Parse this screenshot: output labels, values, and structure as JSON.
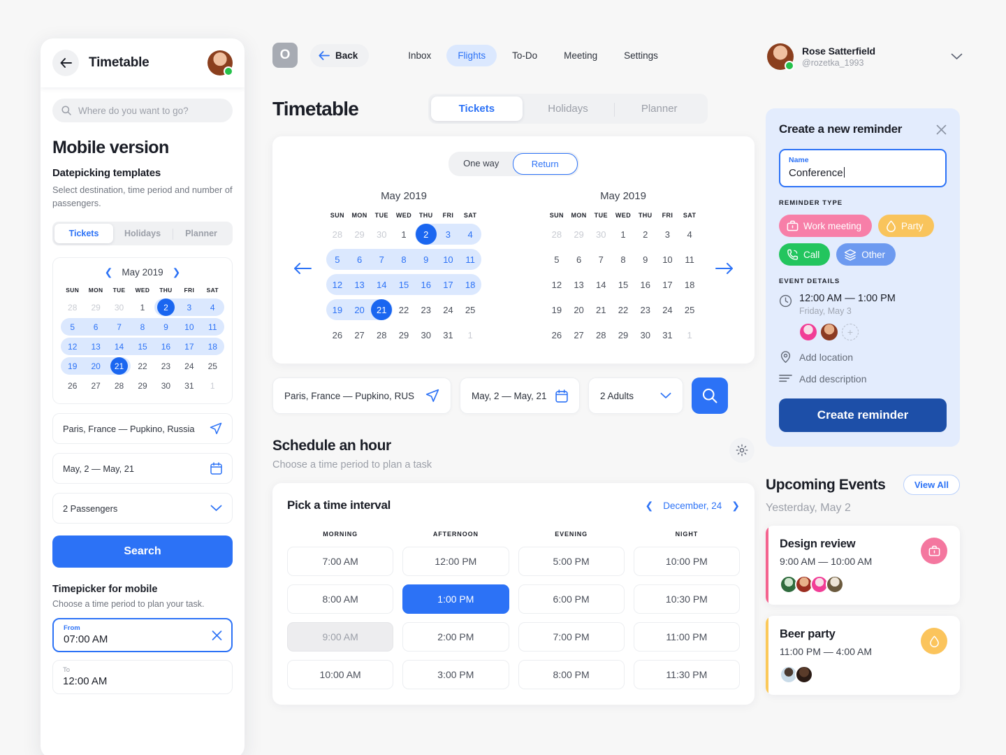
{
  "mobile": {
    "header_title": "Timetable",
    "back_icon": "arrow-left-icon",
    "search_placeholder": "Where do you want to go?",
    "h1": "Mobile version",
    "h2": "Datepicking templates",
    "paragraph": "Select destination, time period and number of passengers.",
    "tabs": [
      {
        "label": "Tickets",
        "active": true
      },
      {
        "label": "Holidays",
        "active": false
      },
      {
        "label": "Planner",
        "active": false
      }
    ],
    "calendar": {
      "month": "May 2019",
      "dow": [
        "SUN",
        "MON",
        "TUE",
        "WED",
        "THU",
        "FRI",
        "SAT"
      ],
      "weeks": [
        [
          {
            "d": "28",
            "s": "mut"
          },
          {
            "d": "29",
            "s": "mut"
          },
          {
            "d": "30",
            "s": "mut"
          },
          {
            "d": "1",
            "s": ""
          },
          {
            "d": "2",
            "s": "sel"
          },
          {
            "d": "3",
            "s": "inr"
          },
          {
            "d": "4",
            "s": "inr"
          }
        ],
        [
          {
            "d": "5",
            "s": "inr"
          },
          {
            "d": "6",
            "s": "inr"
          },
          {
            "d": "7",
            "s": "inr"
          },
          {
            "d": "8",
            "s": "inr"
          },
          {
            "d": "9",
            "s": "inr"
          },
          {
            "d": "10",
            "s": "inr"
          },
          {
            "d": "11",
            "s": "inr"
          }
        ],
        [
          {
            "d": "12",
            "s": "inr"
          },
          {
            "d": "13",
            "s": "inr"
          },
          {
            "d": "14",
            "s": "inr"
          },
          {
            "d": "15",
            "s": "inr"
          },
          {
            "d": "16",
            "s": "inr"
          },
          {
            "d": "17",
            "s": "inr"
          },
          {
            "d": "18",
            "s": "inr"
          }
        ],
        [
          {
            "d": "19",
            "s": "inr"
          },
          {
            "d": "20",
            "s": "inr"
          },
          {
            "d": "21",
            "s": "sel"
          },
          {
            "d": "22",
            "s": ""
          },
          {
            "d": "23",
            "s": ""
          },
          {
            "d": "24",
            "s": ""
          },
          {
            "d": "25",
            "s": ""
          }
        ],
        [
          {
            "d": "26",
            "s": ""
          },
          {
            "d": "27",
            "s": ""
          },
          {
            "d": "28",
            "s": ""
          },
          {
            "d": "29",
            "s": ""
          },
          {
            "d": "30",
            "s": ""
          },
          {
            "d": "31",
            "s": ""
          },
          {
            "d": "1",
            "s": "mut"
          }
        ]
      ]
    },
    "route_field": "Paris, France — Pupkino, Russia",
    "dates_field": "May, 2 — May, 21",
    "passengers_field": "2 Passengers",
    "search_button": "Search",
    "timepicker_title": "Timepicker for mobile",
    "timepicker_sub": "Choose a time period to plan your task.",
    "from_label": "From",
    "from_value": "07:00 AM",
    "to_label": "To",
    "to_value": "12:00 AM"
  },
  "topbar": {
    "logo_letter": "O",
    "back_label": "Back",
    "nav": [
      {
        "label": "Inbox",
        "active": false
      },
      {
        "label": "Flights",
        "active": true
      },
      {
        "label": "To-Do",
        "active": false
      },
      {
        "label": "Meeting",
        "active": false
      },
      {
        "label": "Settings",
        "active": false
      }
    ]
  },
  "profile": {
    "name": "Rose Satterfield",
    "handle": "@rozetka_1993"
  },
  "timetable": {
    "title": "Timetable",
    "tabs": [
      {
        "label": "Tickets",
        "active": true
      },
      {
        "label": "Holidays",
        "active": false
      },
      {
        "label": "Planner",
        "active": false
      }
    ],
    "trip_type": [
      {
        "label": "One way",
        "active": false
      },
      {
        "label": "Return",
        "active": true
      }
    ],
    "calendar_left": {
      "month": "May 2019",
      "dow": [
        "SUN",
        "MON",
        "TUE",
        "WED",
        "THU",
        "FRI",
        "SAT"
      ],
      "weeks": [
        [
          {
            "d": "28",
            "s": "mut"
          },
          {
            "d": "29",
            "s": "mut"
          },
          {
            "d": "30",
            "s": "mut"
          },
          {
            "d": "1",
            "s": ""
          },
          {
            "d": "2",
            "s": "sel"
          },
          {
            "d": "3",
            "s": "inr"
          },
          {
            "d": "4",
            "s": "inr"
          }
        ],
        [
          {
            "d": "5",
            "s": "inr"
          },
          {
            "d": "6",
            "s": "inr"
          },
          {
            "d": "7",
            "s": "inr"
          },
          {
            "d": "8",
            "s": "inr"
          },
          {
            "d": "9",
            "s": "inr"
          },
          {
            "d": "10",
            "s": "inr"
          },
          {
            "d": "11",
            "s": "inr"
          }
        ],
        [
          {
            "d": "12",
            "s": "inr"
          },
          {
            "d": "13",
            "s": "inr"
          },
          {
            "d": "14",
            "s": "inr"
          },
          {
            "d": "15",
            "s": "inr"
          },
          {
            "d": "16",
            "s": "inr"
          },
          {
            "d": "17",
            "s": "inr"
          },
          {
            "d": "18",
            "s": "inr"
          }
        ],
        [
          {
            "d": "19",
            "s": "inr"
          },
          {
            "d": "20",
            "s": "inr"
          },
          {
            "d": "21",
            "s": "sel"
          },
          {
            "d": "22",
            "s": ""
          },
          {
            "d": "23",
            "s": ""
          },
          {
            "d": "24",
            "s": ""
          },
          {
            "d": "25",
            "s": ""
          }
        ],
        [
          {
            "d": "26",
            "s": ""
          },
          {
            "d": "27",
            "s": ""
          },
          {
            "d": "28",
            "s": ""
          },
          {
            "d": "29",
            "s": ""
          },
          {
            "d": "30",
            "s": ""
          },
          {
            "d": "31",
            "s": ""
          },
          {
            "d": "1",
            "s": "mut"
          }
        ]
      ]
    },
    "calendar_right": {
      "month": "May 2019",
      "dow": [
        "SUN",
        "MON",
        "TUE",
        "WED",
        "THU",
        "FRI",
        "SAT"
      ],
      "weeks": [
        [
          {
            "d": "28",
            "s": "mut"
          },
          {
            "d": "29",
            "s": "mut"
          },
          {
            "d": "30",
            "s": "mut"
          },
          {
            "d": "1",
            "s": ""
          },
          {
            "d": "2",
            "s": ""
          },
          {
            "d": "3",
            "s": ""
          },
          {
            "d": "4",
            "s": ""
          }
        ],
        [
          {
            "d": "5",
            "s": ""
          },
          {
            "d": "6",
            "s": ""
          },
          {
            "d": "7",
            "s": ""
          },
          {
            "d": "8",
            "s": ""
          },
          {
            "d": "9",
            "s": ""
          },
          {
            "d": "10",
            "s": ""
          },
          {
            "d": "11",
            "s": ""
          }
        ],
        [
          {
            "d": "12",
            "s": ""
          },
          {
            "d": "13",
            "s": ""
          },
          {
            "d": "14",
            "s": ""
          },
          {
            "d": "15",
            "s": ""
          },
          {
            "d": "16",
            "s": ""
          },
          {
            "d": "17",
            "s": ""
          },
          {
            "d": "18",
            "s": ""
          }
        ],
        [
          {
            "d": "19",
            "s": ""
          },
          {
            "d": "20",
            "s": ""
          },
          {
            "d": "21",
            "s": ""
          },
          {
            "d": "22",
            "s": ""
          },
          {
            "d": "23",
            "s": ""
          },
          {
            "d": "24",
            "s": ""
          },
          {
            "d": "25",
            "s": ""
          }
        ],
        [
          {
            "d": "26",
            "s": ""
          },
          {
            "d": "27",
            "s": ""
          },
          {
            "d": "28",
            "s": ""
          },
          {
            "d": "29",
            "s": ""
          },
          {
            "d": "30",
            "s": ""
          },
          {
            "d": "31",
            "s": ""
          },
          {
            "d": "1",
            "s": "mut"
          }
        ]
      ]
    },
    "search_row": {
      "route": "Paris, France — Pupkino, RUS",
      "dates": "May, 2 — May, 21",
      "passengers": "2 Adults"
    }
  },
  "schedule": {
    "title": "Schedule an hour",
    "subtitle": "Choose a time period to plan a task",
    "gear_icon": "gear-icon",
    "pick_title": "Pick a time interval",
    "pick_date": "December, 24",
    "columns": [
      {
        "header": "MORNING",
        "slots": [
          {
            "label": "7:00 AM",
            "state": ""
          },
          {
            "label": "8:00 AM",
            "state": ""
          },
          {
            "label": "9:00 AM",
            "state": "dis"
          },
          {
            "label": "10:00 AM",
            "state": ""
          }
        ]
      },
      {
        "header": "AFTERNOON",
        "slots": [
          {
            "label": "12:00 PM",
            "state": ""
          },
          {
            "label": "1:00 PM",
            "state": "sel"
          },
          {
            "label": "2:00 PM",
            "state": ""
          },
          {
            "label": "3:00 PM",
            "state": ""
          }
        ]
      },
      {
        "header": "EVENING",
        "slots": [
          {
            "label": "5:00 PM",
            "state": ""
          },
          {
            "label": "6:00 PM",
            "state": ""
          },
          {
            "label": "7:00 PM",
            "state": ""
          },
          {
            "label": "8:00 PM",
            "state": ""
          }
        ]
      },
      {
        "header": "NIGHT",
        "slots": [
          {
            "label": "10:00 PM",
            "state": ""
          },
          {
            "label": "10:30 PM",
            "state": ""
          },
          {
            "label": "11:00 PM",
            "state": ""
          },
          {
            "label": "11:30 PM",
            "state": ""
          }
        ]
      }
    ]
  },
  "reminder": {
    "title": "Create a new reminder",
    "close_icon": "close-icon",
    "name_label": "Name",
    "name_value": "Conference",
    "type_label": "REMINDER TYPE",
    "types": [
      {
        "label": "Work meeting",
        "color": "#f77fa8",
        "icon": "briefcase-icon"
      },
      {
        "label": "Party",
        "color": "#f9c45c",
        "icon": "drop-icon"
      },
      {
        "label": "Call",
        "color": "#23c55e",
        "icon": "phone-icon"
      },
      {
        "label": "Other",
        "color": "#6d9af0",
        "icon": "layers-icon"
      }
    ],
    "details_label": "EVENT DETAILS",
    "time": "12:00 AM — 1:00 PM",
    "date": "Friday, May 3",
    "add_location": "Add location",
    "add_description": "Add description",
    "create_button": "Create reminder",
    "accent": "#1d4fa8"
  },
  "upcoming": {
    "title": "Upcoming Events",
    "view_all": "View All",
    "subtitle": "Yesterday, May 2",
    "events": [
      {
        "name": "Design review",
        "time": "9:00 AM — 10:00 AM",
        "bar_color": "#f4648f",
        "badge_color": "#f4779f",
        "badge_icon": "briefcase-icon",
        "attendees": 4
      },
      {
        "name": "Beer party",
        "time": "11:00 PM — 4:00 AM",
        "bar_color": "#fbc95a",
        "badge_color": "#fbc45c",
        "badge_icon": "drop-icon",
        "attendees": 2
      }
    ]
  }
}
